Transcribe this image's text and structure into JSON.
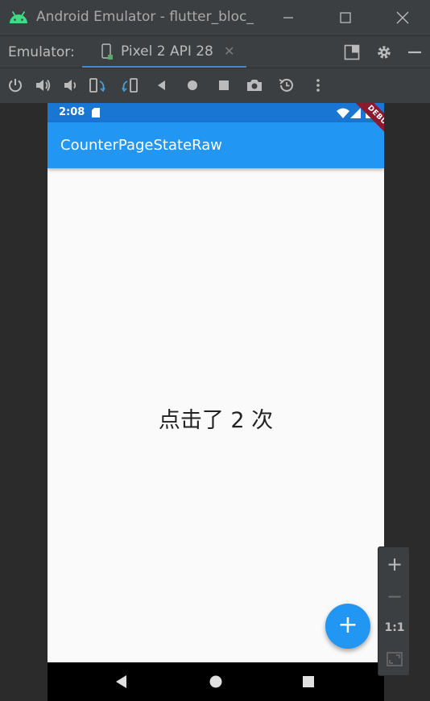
{
  "window": {
    "title": "Android Emulator - flutter_bloc_",
    "minimize_icon": "minimize-icon",
    "maximize_icon": "maximize-icon",
    "close_icon": "close-icon"
  },
  "tabbar": {
    "label": "Emulator:",
    "active_tab": "Pixel 2 API 28",
    "side_icons": [
      "window-mode-icon",
      "gear-icon",
      "hide-icon"
    ]
  },
  "toolbar": {
    "icons": [
      "power-icon",
      "volume-up-icon",
      "volume-down-icon",
      "rotate-left-icon",
      "rotate-right-icon",
      "back-icon",
      "home-icon",
      "overview-icon",
      "screenshot-icon",
      "snapshot-icon",
      "more-icon"
    ]
  },
  "device": {
    "status_time": "2:08",
    "app_title": "CounterPageStateRaw",
    "debug_banner": "DEBUG",
    "counter_text": "点击了 2 次",
    "fab_label": "+",
    "accent_color": "#2196f3",
    "status_color": "#1976d2"
  },
  "zoom": {
    "zoom_in": "+",
    "zoom_out": "−",
    "actual_size": "1:1"
  }
}
